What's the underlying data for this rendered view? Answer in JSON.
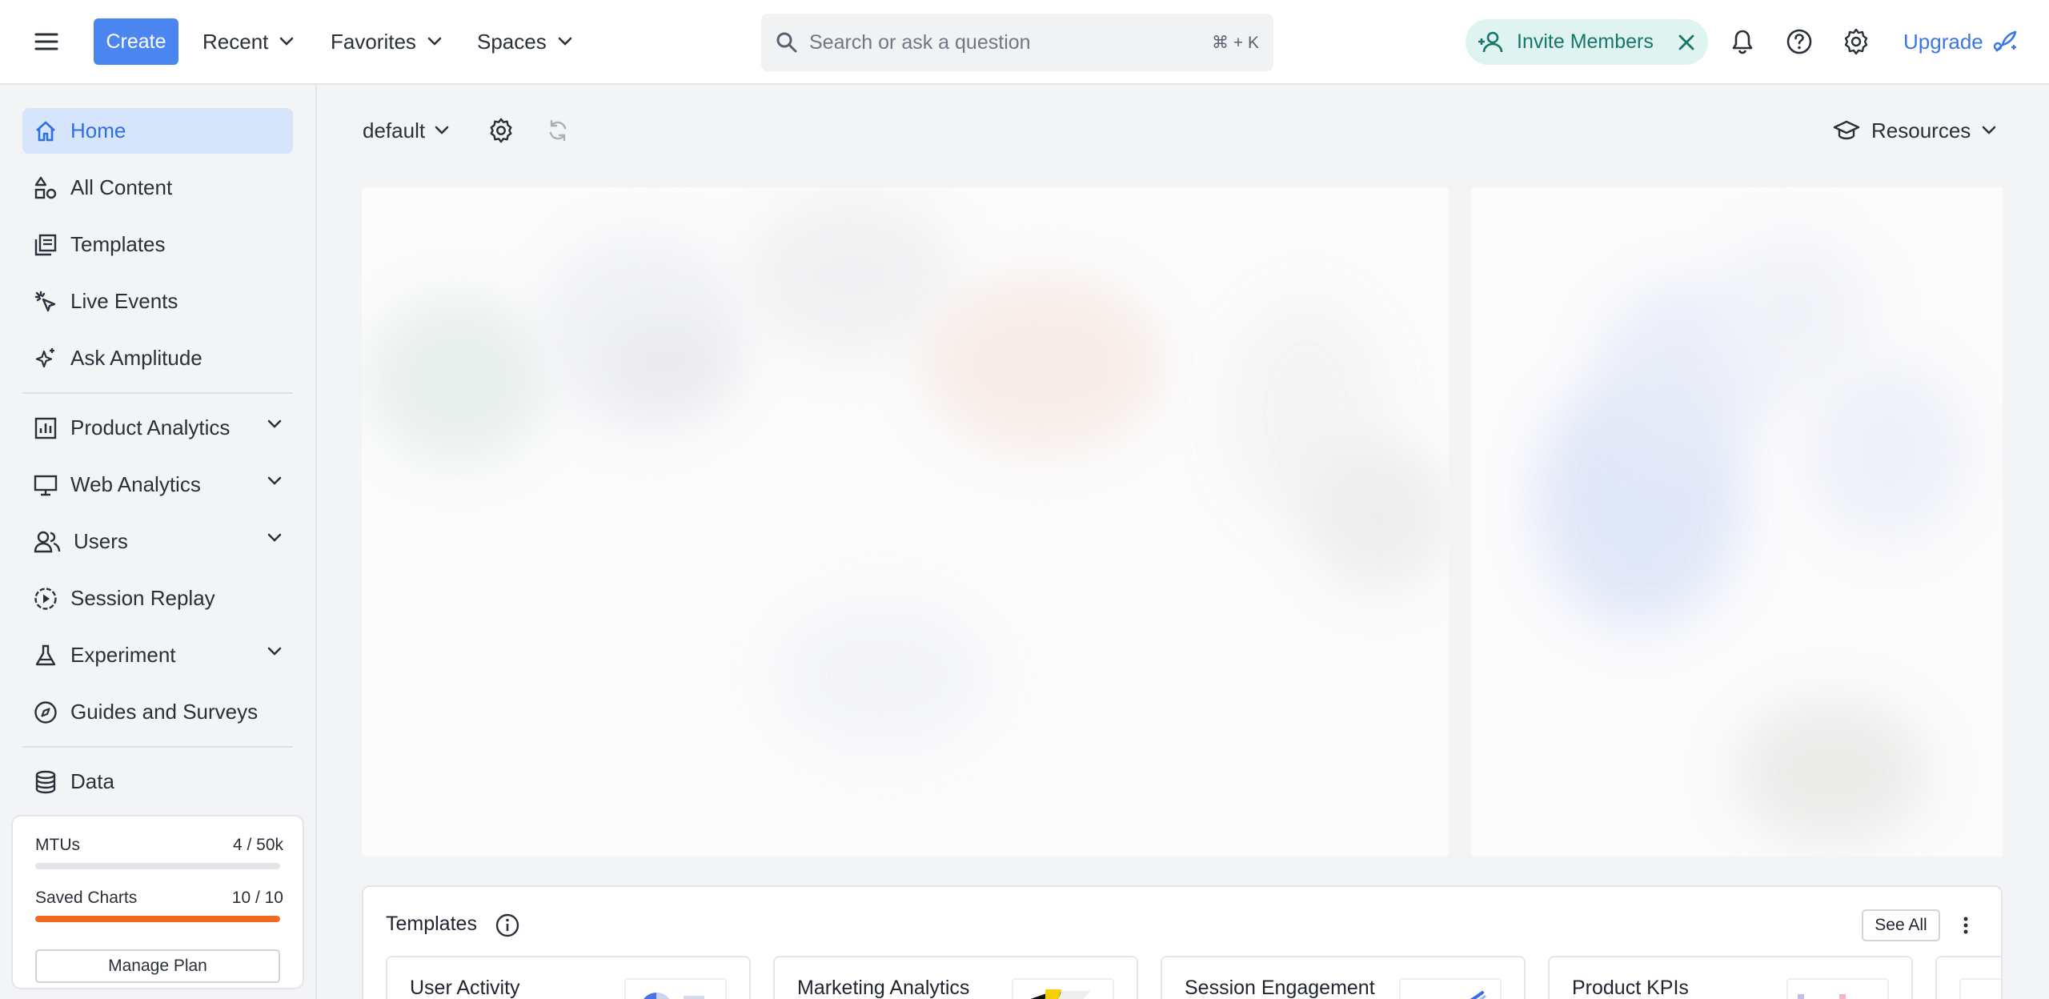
{
  "topbar": {
    "create_label": "Create",
    "nav": [
      {
        "label": "Recent"
      },
      {
        "label": "Favorites"
      },
      {
        "label": "Spaces"
      }
    ],
    "search_placeholder": "Search or ask a question",
    "search_shortcut": "⌘ + K",
    "invite_label": "Invite Members",
    "upgrade_label": "Upgrade"
  },
  "sidebar": {
    "items": [
      {
        "label": "Home",
        "icon": "home-icon",
        "active": true
      },
      {
        "label": "All Content",
        "icon": "shapes-icon"
      },
      {
        "label": "Templates",
        "icon": "templates-icon"
      },
      {
        "label": "Live Events",
        "icon": "live-events-icon"
      },
      {
        "label": "Ask Amplitude",
        "icon": "sparkle-icon"
      },
      {
        "label": "Product Analytics",
        "icon": "bar-chart-icon",
        "expandable": true
      },
      {
        "label": "Web Analytics",
        "icon": "monitor-icon",
        "expandable": true
      },
      {
        "label": "Users",
        "icon": "users-icon",
        "expandable": true
      },
      {
        "label": "Session Replay",
        "icon": "play-circle-icon"
      },
      {
        "label": "Experiment",
        "icon": "flask-icon",
        "expandable": true
      },
      {
        "label": "Guides and Surveys",
        "icon": "compass-icon"
      },
      {
        "label": "Data",
        "icon": "database-icon"
      }
    ],
    "usage": {
      "mtus_label": "MTUs",
      "mtus_value": "4 / 50k",
      "mtus_fraction": 0.0001,
      "charts_label": "Saved Charts",
      "charts_value": "10 / 10",
      "charts_fraction": 1.0,
      "manage_label": "Manage Plan"
    }
  },
  "main": {
    "workspace_label": "default",
    "resources_label": "Resources",
    "templates": {
      "title": "Templates",
      "see_all_label": "See All",
      "cards": [
        {
          "name": "User Activity"
        },
        {
          "name": "Marketing Analytics"
        },
        {
          "name": "Session Engagement"
        },
        {
          "name": "Product KPIs"
        }
      ]
    }
  },
  "colors": {
    "accent": "#4b86f0",
    "active_bg": "#d6e5fb",
    "invite_bg": "#dff4f0",
    "invite_text": "#17756a",
    "progress_full": "#f06a22"
  }
}
